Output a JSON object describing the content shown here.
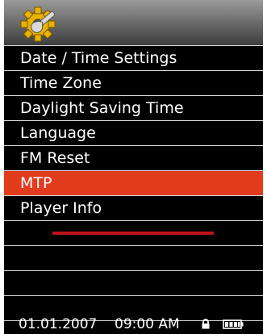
{
  "header": {
    "icon": "settings-gear-wrench-icon"
  },
  "menu": {
    "items": [
      {
        "label": "Date / Time Settings",
        "selected": false
      },
      {
        "label": "Time Zone",
        "selected": false
      },
      {
        "label": "Daylight Saving Time",
        "selected": false
      },
      {
        "label": "Language",
        "selected": false
      },
      {
        "label": "FM Reset",
        "selected": false
      },
      {
        "label": "MTP",
        "selected": true
      },
      {
        "label": "Player Info",
        "selected": false
      }
    ]
  },
  "status": {
    "date": "01.01.2007",
    "time": "09:00 AM",
    "lock_icon": "lock-icon",
    "battery_icon": "battery-icon"
  },
  "colors": {
    "background": "#000000",
    "selection": "#e23b1e",
    "separator": "#d8d8d8",
    "accent_line": "#c0141a",
    "header_gradient_top": "#9b9b9b",
    "header_gradient_bottom": "#3e3e3e"
  }
}
